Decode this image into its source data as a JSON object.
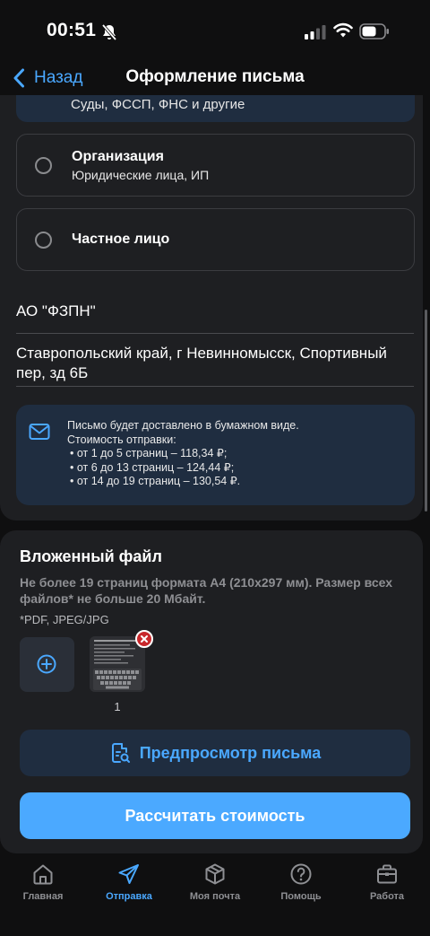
{
  "status_bar": {
    "time": "00:51"
  },
  "nav": {
    "back_label": "Назад",
    "title": "Оформление письма"
  },
  "recipient_options": {
    "partial_subtitle": "Суды, ФССП, ФНС и другие",
    "items": [
      {
        "title": "Организация",
        "subtitle": "Юридические лица, ИП"
      },
      {
        "title": "Частное лицо",
        "subtitle": ""
      }
    ]
  },
  "recipient": {
    "name": "АО \"ФЗПН\"",
    "address": "Ставропольский край, г Невинномысск, Спортивный пер, зд 6Б"
  },
  "info": {
    "line1": "Письмо будет доставлено в бумажном виде.",
    "line2": "Стоимость отправки:",
    "bullets": [
      "• от 1 до 5 страниц – 118,34 ₽;",
      "• от 6 до 13 страниц – 124,44 ₽;",
      "• от 14 до 19 страниц – 130,54 ₽."
    ]
  },
  "attachment": {
    "title": "Вложенный файл",
    "description": "Не более 19 страниц формата А4 (210x297 мм). Размер всех файлов* не больше 20 Мбайт.",
    "formats": "*PDF, JPEG/JPG",
    "files": [
      {
        "caption": "1"
      }
    ]
  },
  "buttons": {
    "preview": "Предпросмотр письма",
    "calculate": "Рассчитать стоимость"
  },
  "tab_bar": {
    "items": [
      {
        "label": "Главная",
        "icon": "home-icon"
      },
      {
        "label": "Отправка",
        "icon": "send-icon"
      },
      {
        "label": "Моя почта",
        "icon": "box-icon"
      },
      {
        "label": "Помощь",
        "icon": "help-icon"
      },
      {
        "label": "Работа",
        "icon": "briefcase-icon"
      }
    ],
    "active_index": 1
  },
  "colors": {
    "accent": "#4aa8ff",
    "card": "#1e1f22",
    "info_bg": "#1f2d40",
    "background": "#0f0f10"
  }
}
